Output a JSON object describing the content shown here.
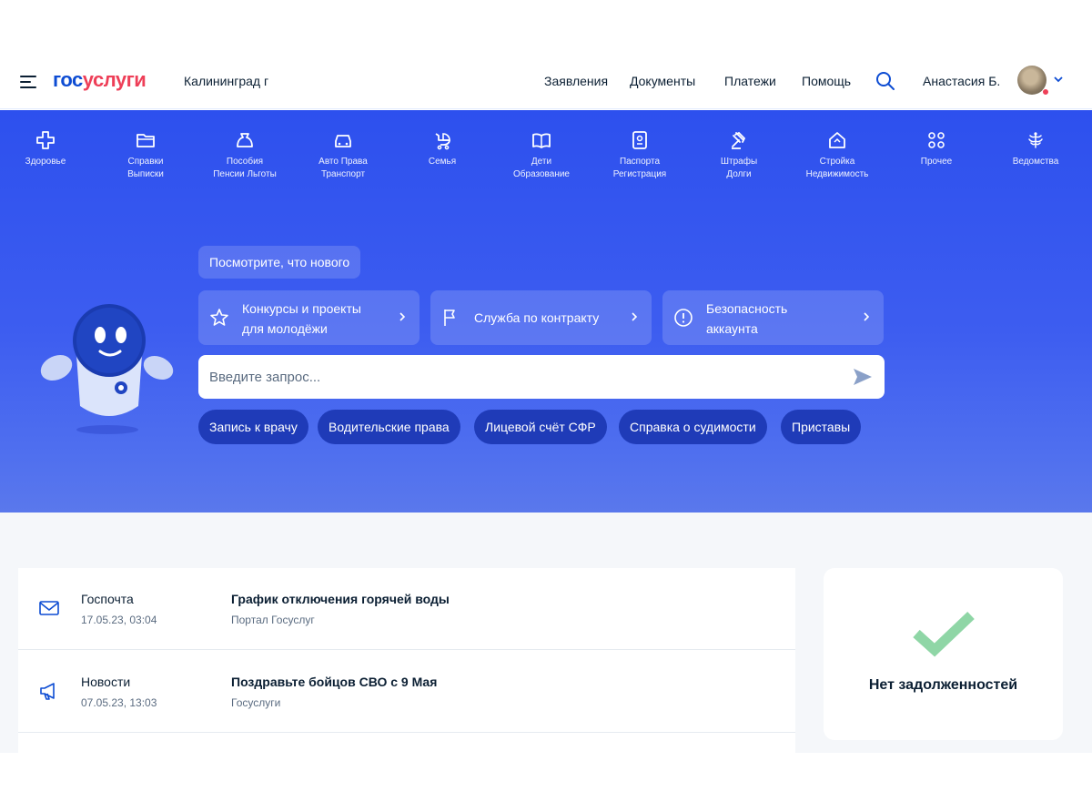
{
  "header": {
    "logo_part1": "гос",
    "logo_part2": "услуги",
    "city": "Калининград г",
    "nav": [
      "Заявления",
      "Документы",
      "Платежи",
      "Помощь"
    ],
    "user_name": "Анастасия Б.",
    "notification_color": "#ee3f58"
  },
  "categories": [
    {
      "label": "Здоровье",
      "icon": "health-cross-icon"
    },
    {
      "label": "Справки\nВыписки",
      "icon": "folder-icon"
    },
    {
      "label": "Пособия\nПенсии Льготы",
      "icon": "wallet-bag-icon"
    },
    {
      "label": "Авто Права\nТранспорт",
      "icon": "car-icon"
    },
    {
      "label": "Семья",
      "icon": "stroller-icon"
    },
    {
      "label": "Дети\nОбразование",
      "icon": "book-icon"
    },
    {
      "label": "Паспорта\nРегистрация",
      "icon": "passport-icon"
    },
    {
      "label": "Штрафы\nДолги",
      "icon": "gavel-icon"
    },
    {
      "label": "Стройка\nНедвижимость",
      "icon": "house-icon"
    },
    {
      "label": "Прочее",
      "icon": "grid-icon"
    },
    {
      "label": "Ведомства",
      "icon": "eagle-emblem-icon"
    }
  ],
  "hero": {
    "whats_new": "Посмотрите, что нового",
    "cards": [
      {
        "label": "Конкурсы и проекты\nдля молодёжи",
        "icon": "star-icon"
      },
      {
        "label": "Служба по контракту",
        "icon": "flag-icon"
      },
      {
        "label": "Безопасность\nаккаунта",
        "icon": "info-circle-icon"
      }
    ],
    "search_placeholder": "Введите запрос...",
    "chips": [
      "Запись к врачу",
      "Водительские права",
      "Лицевой счёт СФР",
      "Справка о судимости",
      "Приставы"
    ]
  },
  "feed": [
    {
      "source": "Госпочта",
      "date": "17.05.23, 03:04",
      "title": "График отключения горячей воды",
      "subtitle": "Портал Госуслуг",
      "icon": "envelope-icon"
    },
    {
      "source": "Новости",
      "date": "07.05.23, 13:03",
      "title": "Поздравьте бойцов СВО с 9 Мая",
      "subtitle": "Госуслуги",
      "icon": "megaphone-icon"
    }
  ],
  "debt": {
    "label": "Нет задолженностей",
    "icon": "checkmark-icon",
    "check_color": "#8fd6a6"
  },
  "colors": {
    "primary": "#0d4cd3",
    "hero": "#2d50ee",
    "chip": "#1f3bb8"
  }
}
